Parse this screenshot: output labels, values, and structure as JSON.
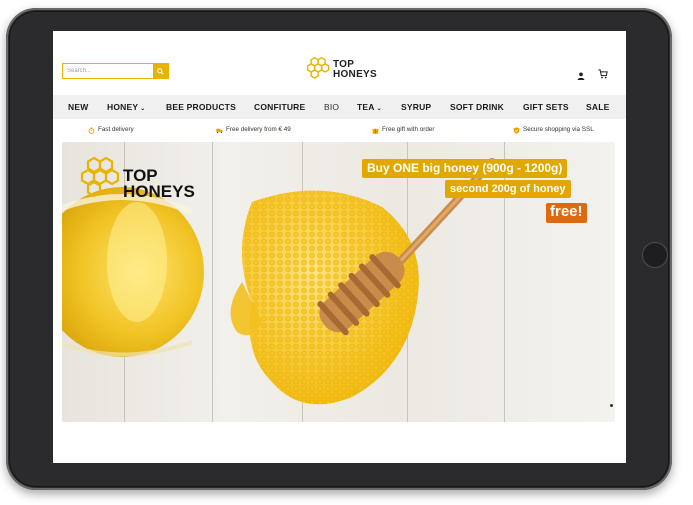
{
  "search": {
    "placeholder": "Search..."
  },
  "brand": {
    "line1": "TOP",
    "line2": "HONEYS"
  },
  "nav": {
    "items": [
      {
        "label": "NEW",
        "caret": ""
      },
      {
        "label": "HONEY",
        "caret": "⌄"
      },
      {
        "label": "BEE PRODUCTS",
        "caret": ""
      },
      {
        "label": "CONFITURE",
        "caret": ""
      },
      {
        "label": "BIO",
        "caret": ""
      },
      {
        "label": "TEA",
        "caret": "⌄"
      },
      {
        "label": "SYRUP",
        "caret": ""
      },
      {
        "label": "SOFT DRINK",
        "caret": ""
      },
      {
        "label": "GIFT SETS",
        "caret": ""
      },
      {
        "label": "SALE",
        "caret": ""
      }
    ]
  },
  "features": [
    {
      "label": "Fast delivery",
      "icon": "stopwatch-icon"
    },
    {
      "label": "Free delivery from € 49",
      "icon": "truck-icon"
    },
    {
      "label": "Free gift with order",
      "icon": "gift-icon"
    },
    {
      "label": "Secure shopping via SSL",
      "icon": "shield-icon"
    }
  ],
  "hero": {
    "promo_line1": "Buy ONE big honey (900g - 1200g)",
    "promo_line2": "second 200g of honey",
    "promo_line3": "free!"
  },
  "colors": {
    "accent": "#e8b400",
    "promo_bg": "#e0a800",
    "free_bg": "#dd6a0f",
    "nav_bg": "#f0f0f0"
  }
}
